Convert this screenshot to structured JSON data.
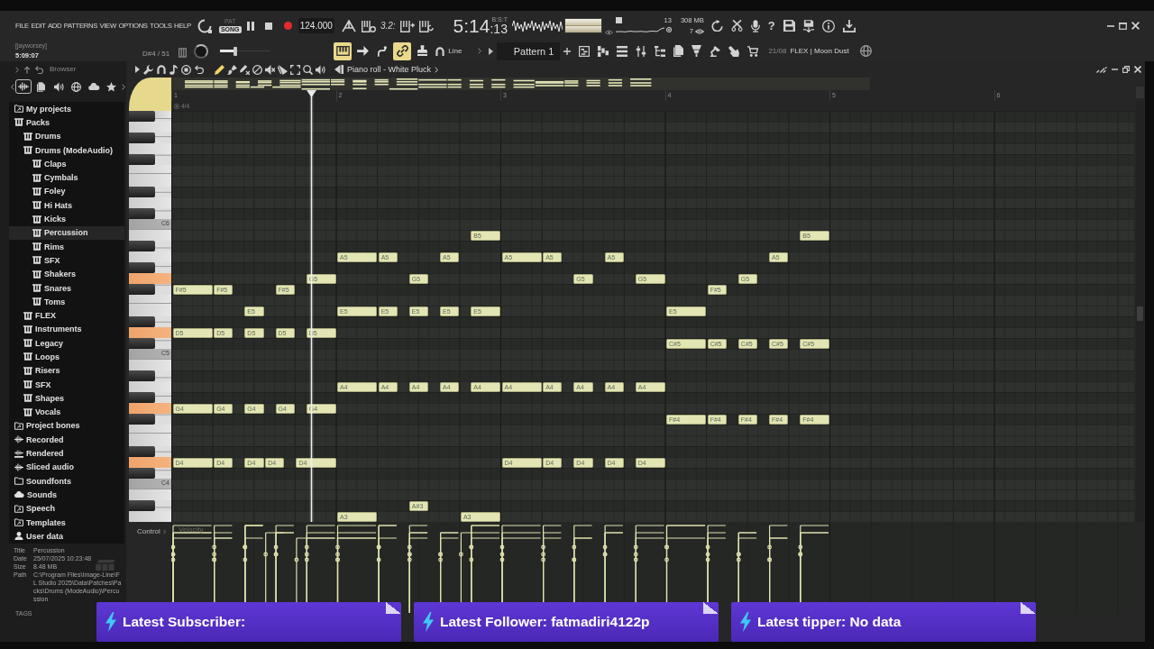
{
  "menu": [
    "FILE",
    "EDIT",
    "ADD",
    "PATTERNS",
    "VIEW",
    "OPTIONS",
    "TOOLS",
    "HELP"
  ],
  "transport": {
    "modes": [
      {
        "label": "PAT",
        "selected": false
      },
      {
        "label": "SONG",
        "selected": true
      }
    ],
    "playing": true,
    "tempo": "124.000",
    "countdown": "3.2:"
  },
  "song_position": {
    "main": "5:14",
    "ticks": ":13",
    "units": "B:S:T"
  },
  "monitor": {
    "cpu": "13",
    "memory": "308 MB",
    "polyphony": "7"
  },
  "help": "?",
  "user": {
    "name": "[jayworsey]",
    "time": "5:09:07"
  },
  "hint": "D#4 / 51",
  "master_slider": {
    "level": 0.3
  },
  "toggles": [
    {
      "on": true
    },
    {
      "on": false
    },
    {
      "on": false
    },
    {
      "on": true
    },
    {
      "on": false
    }
  ],
  "snap": "Line",
  "pattern": "Pattern 1",
  "project": {
    "date": "21/08",
    "title": "FLEX | Moon Dust"
  },
  "browser": {
    "title": "Browser",
    "tabs": [
      {
        "selected": true
      },
      {
        "selected": false
      },
      {
        "selected": false
      },
      {
        "selected": false
      },
      {
        "selected": false
      },
      {
        "selected": false
      }
    ],
    "tree": [
      {
        "label": "My projects",
        "kind": "shortcut",
        "selected": false
      },
      {
        "label": "Packs",
        "kind": "pack",
        "selected": false,
        "children": [
          {
            "label": "Drums",
            "kind": "pack",
            "selected": false
          },
          {
            "label": "Drums (ModeAudio)",
            "kind": "pack",
            "selected": false,
            "children": [
              {
                "label": "Claps",
                "kind": "pack",
                "selected": false
              },
              {
                "label": "Cymbals",
                "kind": "pack",
                "selected": false
              },
              {
                "label": "Foley",
                "kind": "pack",
                "selected": false
              },
              {
                "label": "Hi Hats",
                "kind": "pack",
                "selected": false
              },
              {
                "label": "Kicks",
                "kind": "pack",
                "selected": false
              },
              {
                "label": "Percussion",
                "kind": "pack",
                "selected": true
              },
              {
                "label": "Rims",
                "kind": "pack",
                "selected": false
              },
              {
                "label": "SFX",
                "kind": "pack",
                "selected": false
              },
              {
                "label": "Shakers",
                "kind": "pack",
                "selected": false
              },
              {
                "label": "Snares",
                "kind": "pack",
                "selected": false
              },
              {
                "label": "Toms",
                "kind": "pack",
                "selected": false
              }
            ]
          },
          {
            "label": "FLEX",
            "kind": "pack",
            "selected": false
          },
          {
            "label": "Instruments",
            "kind": "pack",
            "selected": false
          },
          {
            "label": "Legacy",
            "kind": "pack",
            "selected": false
          },
          {
            "label": "Loops",
            "kind": "pack",
            "selected": false
          },
          {
            "label": "Risers",
            "kind": "pack",
            "selected": false
          },
          {
            "label": "SFX",
            "kind": "pack",
            "selected": false
          },
          {
            "label": "Shapes",
            "kind": "pack",
            "selected": false
          },
          {
            "label": "Vocals",
            "kind": "pack",
            "selected": false
          }
        ]
      },
      {
        "label": "Project bones",
        "kind": "shortcut",
        "selected": false
      },
      {
        "label": "Recorded",
        "kind": "audio",
        "selected": false
      },
      {
        "label": "Rendered",
        "kind": "rendered",
        "selected": false
      },
      {
        "label": "Sliced audio",
        "kind": "audio",
        "selected": false
      },
      {
        "label": "Soundfonts",
        "kind": "folder",
        "selected": false
      },
      {
        "label": "Sounds",
        "kind": "cloud",
        "selected": false
      },
      {
        "label": "Speech",
        "kind": "shortcut",
        "selected": false
      },
      {
        "label": "Templates",
        "kind": "shortcut",
        "selected": false
      },
      {
        "label": "User data",
        "kind": "user",
        "selected": false
      }
    ],
    "info": [
      {
        "label": "Title",
        "value": "Percussion"
      },
      {
        "label": "Date",
        "value": "25/07/2025 10:23:48"
      },
      {
        "label": "Size",
        "value": "8.48 MB"
      },
      {
        "label": "Path",
        "value": "C:\\Program Files\\Image-Line\\FL Studio 2025\\Data\\Patches\\Packs\\Drums (ModeAudio)\\Percussion"
      }
    ],
    "tags_label": "TAGS"
  },
  "piano_roll": {
    "title": "Piano roll - White Pluck",
    "tools": [
      {
        "selected": true
      },
      {
        "selected": false
      },
      {
        "selected": false
      },
      {
        "selected": false
      },
      {
        "selected": false
      },
      {
        "selected": false
      },
      {
        "selected": false
      },
      {
        "selected": false
      },
      {
        "selected": false
      }
    ],
    "ruler": [
      "1",
      "2",
      "3",
      "4",
      "5",
      "6"
    ],
    "time_signature": "4/4",
    "keyboard": {
      "white_keys": [
        {
          "pressed": false
        },
        {
          "pressed": false
        },
        {
          "pressed": false
        },
        {
          "pressed": false
        },
        {
          "pressed": false
        },
        {
          "pressed": false
        },
        {
          "label": "C6",
          "pressed": false
        },
        {
          "pressed": false
        },
        {
          "pressed": false
        },
        {
          "pressed": true
        },
        {
          "pressed": false
        },
        {
          "pressed": false
        },
        {
          "pressed": true
        },
        {
          "label": "C5",
          "pressed": false
        },
        {
          "pressed": false
        },
        {
          "pressed": false
        },
        {
          "pressed": true
        },
        {
          "pressed": false
        },
        {
          "pressed": false
        },
        {
          "pressed": true
        },
        {
          "label": "C4",
          "pressed": false
        },
        {
          "pressed": false
        },
        {
          "pressed": false
        }
      ]
    },
    "notes": [
      {
        "label": "B5"
      },
      {
        "label": "B5"
      },
      {
        "label": "A5"
      },
      {
        "label": "A5"
      },
      {
        "label": "A5"
      },
      {
        "label": "A5"
      },
      {
        "label": "A5"
      },
      {
        "label": "A5"
      },
      {
        "label": "A5"
      },
      {
        "label": "G5"
      },
      {
        "label": "G5"
      },
      {
        "label": "G5"
      },
      {
        "label": "G5"
      },
      {
        "label": "G5"
      },
      {
        "label": "F#5"
      },
      {
        "label": "F#5"
      },
      {
        "label": "F#5"
      },
      {
        "label": "F#5"
      },
      {
        "label": "E5"
      },
      {
        "label": "E5"
      },
      {
        "label": "E5"
      },
      {
        "label": "E5"
      },
      {
        "label": "E5"
      },
      {
        "label": "E5"
      },
      {
        "label": "E5"
      },
      {
        "label": "D5"
      },
      {
        "label": "D5"
      },
      {
        "label": "D5"
      },
      {
        "label": "D5"
      },
      {
        "label": "D5"
      },
      {
        "label": "C#5"
      },
      {
        "label": "C#5"
      },
      {
        "label": "C#5"
      },
      {
        "label": "C#5"
      },
      {
        "label": "C#5"
      },
      {
        "label": "A4"
      },
      {
        "label": "A4"
      },
      {
        "label": "A4"
      },
      {
        "label": "A4"
      },
      {
        "label": "A4"
      },
      {
        "label": "A4"
      },
      {
        "label": "A4"
      },
      {
        "label": "A4"
      },
      {
        "label": "A4"
      },
      {
        "label": "A4"
      },
      {
        "label": "G4"
      },
      {
        "label": "G4"
      },
      {
        "label": "G4"
      },
      {
        "label": "G4"
      },
      {
        "label": "G4"
      },
      {
        "label": "F#4"
      },
      {
        "label": "F#4"
      },
      {
        "label": "F#4"
      },
      {
        "label": "F#4"
      },
      {
        "label": "F#4"
      },
      {
        "label": "D4"
      },
      {
        "label": "D4"
      },
      {
        "label": "D4"
      },
      {
        "label": "D4"
      },
      {
        "label": "D4"
      },
      {
        "label": "D4"
      },
      {
        "label": "D4"
      },
      {
        "label": "D4"
      },
      {
        "label": "D4"
      },
      {
        "label": "D4"
      },
      {
        "label": "A#3"
      },
      {
        "label": "A3"
      },
      {
        "label": "A3"
      }
    ],
    "control": {
      "label": "Control",
      "parameter": "Velocity"
    }
  },
  "alerts": [
    {
      "text": "Latest Subscriber:"
    },
    {
      "text": "Latest Follower: fatmadiri4122p"
    },
    {
      "text": "Latest tipper: No data"
    }
  ]
}
